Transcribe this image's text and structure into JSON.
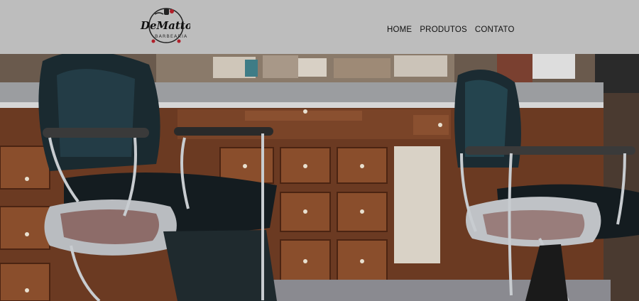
{
  "brand": {
    "logo_name": "DeMattos",
    "logo_sub": "BARBEARIA"
  },
  "nav": {
    "items": [
      {
        "label": "HOME"
      },
      {
        "label": "PRODUTOS"
      },
      {
        "label": "CONTATO"
      }
    ]
  },
  "hero": {
    "image_subject": "barbershop-chairs-photo"
  },
  "colors": {
    "header_bg": "#bdbdbd",
    "nav_text": "#111111",
    "wood": "#6b3a22",
    "leather": "#1a2a30"
  }
}
